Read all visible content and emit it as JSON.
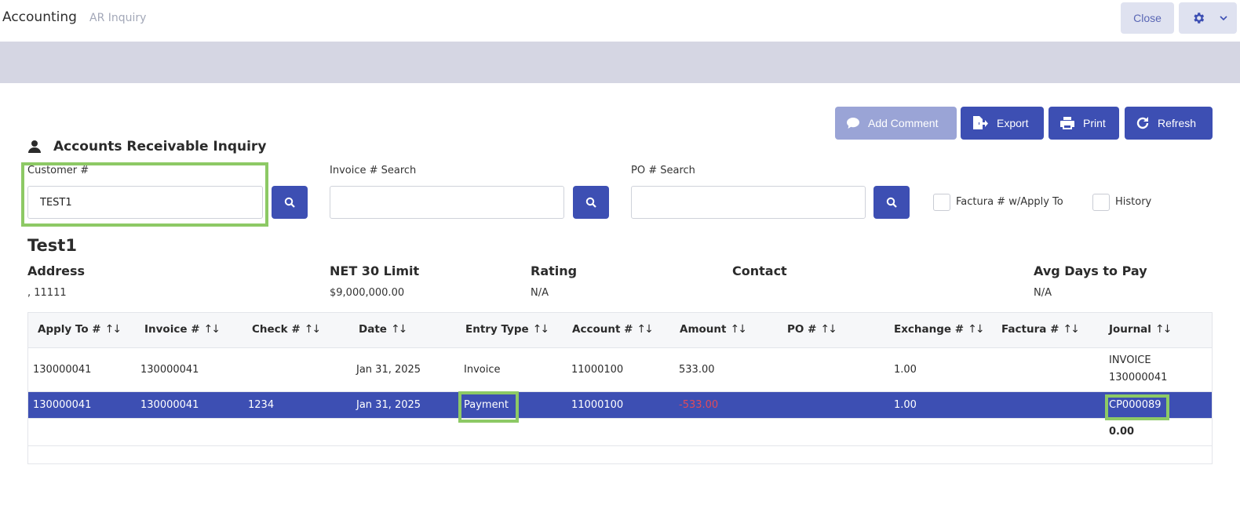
{
  "header": {
    "app_title": "Accounting",
    "breadcrumb": "AR Inquiry",
    "close_label": "Close",
    "settings_icon": "gear-icon"
  },
  "actions": {
    "add_comment": "Add Comment",
    "export": "Export",
    "print": "Print",
    "refresh": "Refresh"
  },
  "section_title": "Accounts Receivable Inquiry",
  "search": {
    "customer_label": "Customer #",
    "customer_value": "TEST1",
    "invoice_label": "Invoice # Search",
    "invoice_value": "",
    "po_label": "PO # Search",
    "po_value": "",
    "factura_label": "Factura # w/Apply To",
    "history_label": "History"
  },
  "customer": {
    "name": "Test1",
    "address_label": "Address",
    "address_value": ", 11111",
    "limit_label": "NET 30 Limit",
    "limit_value": "$9,000,000.00",
    "rating_label": "Rating",
    "rating_value": "N/A",
    "contact_label": "Contact",
    "contact_value": "",
    "avg_label": "Avg Days to Pay",
    "avg_value": "N/A"
  },
  "table": {
    "sort_glyph": "↑↓",
    "columns": [
      "Apply To #",
      "Invoice #",
      "Check #",
      "Date",
      "Entry Type",
      "Account #",
      "Amount",
      "PO #",
      "Exchange #",
      "Factura #",
      "Journal"
    ],
    "rows": [
      {
        "apply_to": "130000041",
        "invoice": "130000041",
        "check": "",
        "date": "Jan 31, 2025",
        "entry_type": "Invoice",
        "account": "11000100",
        "amount": "533.00",
        "po": "",
        "exchange": "1.00",
        "factura": "",
        "journal_line1": "INVOICE",
        "journal_line2": "130000041"
      },
      {
        "apply_to": "130000041",
        "invoice": "130000041",
        "check": "1234",
        "date": "Jan 31, 2025",
        "entry_type": "Payment",
        "account": "11000100",
        "amount": "-533.00",
        "po": "",
        "exchange": "1.00",
        "factura": "",
        "journal": "CP000089"
      }
    ],
    "total": "0.00"
  },
  "colors": {
    "primary": "#3d4fb3",
    "highlight": "#8dc965",
    "negative": "#e04a5a"
  }
}
